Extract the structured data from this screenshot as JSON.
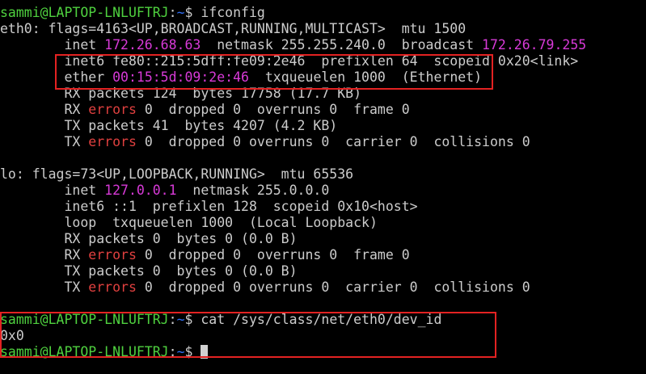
{
  "terminal": {
    "prompt_user": "sammi@LAPTOP-LNLUFTRJ",
    "prompt_sep": ":",
    "prompt_path": "~",
    "prompt_symbol": "$ ",
    "cmd_ifconfig": "ifconfig",
    "eth0": {
      "header": "eth0: flags=4163<UP,BROADCAST,RUNNING,MULTICAST>  mtu 1500",
      "inet_label": "        inet ",
      "inet_addr": "172.26.68.63",
      "netmask_broadcast": "  netmask 255.255.240.0  broadcast ",
      "broadcast_addr": "172.26.79.255",
      "inet6": "        inet6 fe80::215:5dff:fe09:2e46  prefixlen 64  scopeid 0x20<link>",
      "ether_label": "        ether ",
      "ether_addr": "00:15:5d:09:2e:46",
      "ether_rest": "  txqueuelen 1000  (Ethernet)",
      "rx_packets": "        RX packets 124  bytes 17758 (17.7 KB)",
      "rx_prefix": "        RX ",
      "rx_errors_word": "errors",
      "rx_errors_rest": " 0  dropped 0  overruns 0  frame 0",
      "tx_packets": "        TX packets 41  bytes 4207 (4.2 KB)",
      "tx_prefix": "        TX ",
      "tx_errors_word": "errors",
      "tx_errors_rest": " 0  dropped 0 overruns 0  carrier 0  collisions 0"
    },
    "lo": {
      "header": "lo: flags=73<UP,LOOPBACK,RUNNING>  mtu 65536",
      "inet_label": "        inet ",
      "inet_addr": "127.0.0.1",
      "netmask": "  netmask 255.0.0.0",
      "inet6": "        inet6 ::1  prefixlen 128  scopeid 0x10<host>",
      "loop": "        loop  txqueuelen 1000  (Local Loopback)",
      "rx_packets": "        RX packets 0  bytes 0 (0.0 B)",
      "rx_prefix": "        RX ",
      "rx_errors_word": "errors",
      "rx_errors_rest": " 0  dropped 0  overruns 0  frame 0",
      "tx_packets": "        TX packets 0  bytes 0 (0.0 B)",
      "tx_prefix": "        TX ",
      "tx_errors_word": "errors",
      "tx_errors_rest": " 0  dropped 0 overruns 0  carrier 0  collisions 0"
    },
    "cmd_cat": "cat /sys/class/net/eth0/dev_id",
    "cat_output": "0x0"
  },
  "colors": {
    "background": "#000000",
    "text": "#cccccc",
    "prompt_user": "#4fd13f",
    "prompt_path": "#2f6ef5",
    "address_highlight": "#d83ad8",
    "errors_word": "#e0403f",
    "annotation_box": "#e32222"
  }
}
